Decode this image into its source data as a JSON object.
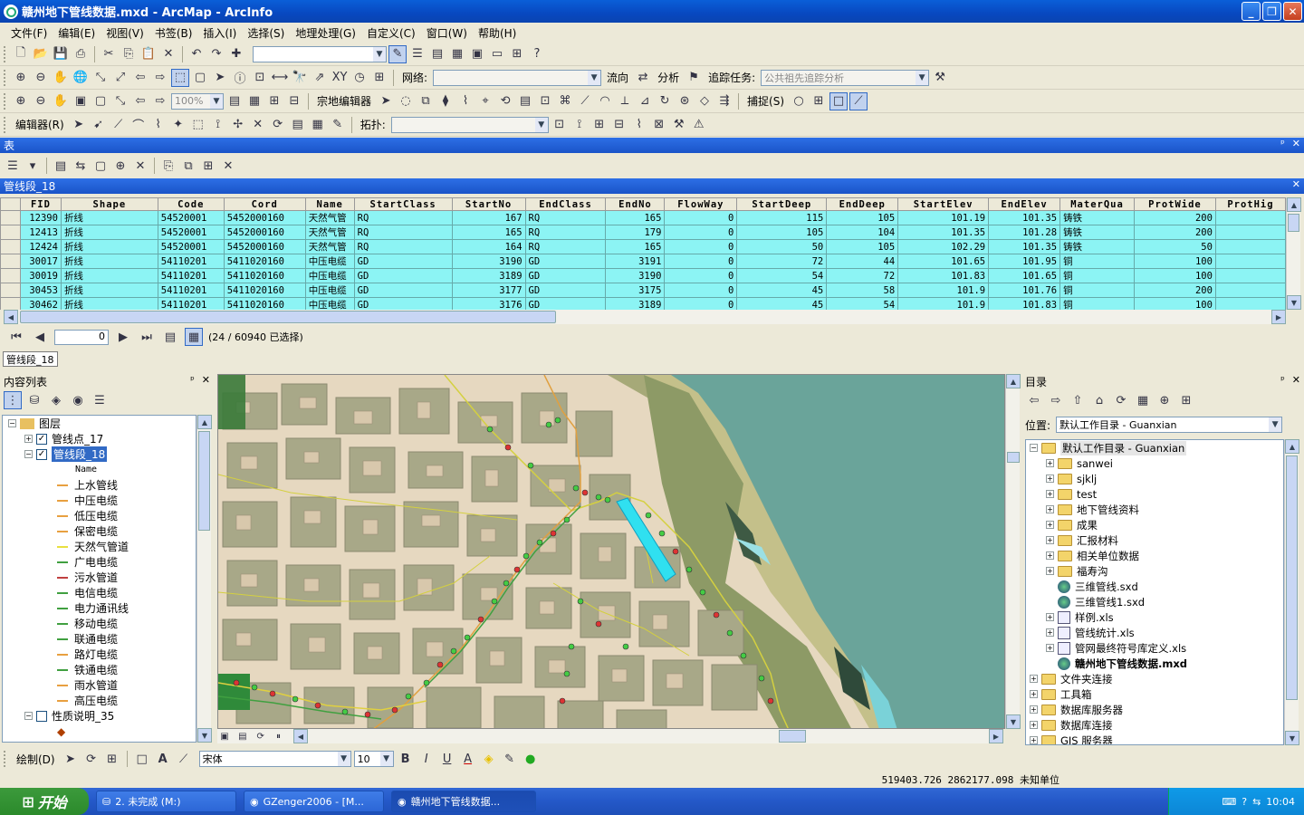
{
  "window": {
    "title": "赣州地下管线数据.mxd - ArcMap - ArcInfo",
    "min": "_",
    "max": "❐",
    "close": "✕"
  },
  "menu": [
    "文件(F)",
    "编辑(E)",
    "视图(V)",
    "书签(B)",
    "插入(I)",
    "选择(S)",
    "地理处理(G)",
    "自定义(C)",
    "窗口(W)",
    "帮助(H)"
  ],
  "toolbars": {
    "network_label": "网络:",
    "flow_label": "流向",
    "analysis_label": "分析",
    "trace_label": "追踪任务:",
    "trace_value": "公共祖先追踪分析",
    "zoom_value": "100%",
    "parcel_editor": "宗地编辑器",
    "snapping": "捕捉(S)",
    "editor": "编辑器(R)",
    "topology_label": "拓扑:"
  },
  "table_panel": {
    "title": "表",
    "layer_title": "管线段_18",
    "pin": "ᵖ",
    "close": "✕"
  },
  "table": {
    "columns": [
      "FID",
      "Shape",
      "Code",
      "Cord",
      "Name",
      "StartClass",
      "StartNo",
      "EndClass",
      "EndNo",
      "FlowWay",
      "StartDeep",
      "EndDeep",
      "StartElev",
      "EndElev",
      "MaterQua",
      "ProtWide",
      "ProtHig"
    ],
    "rows": [
      [
        "12390",
        "折线",
        "54520001",
        "5452000160",
        "天然气管",
        "RQ",
        "167",
        "RQ",
        "165",
        "0",
        "115",
        "105",
        "101.19",
        "101.35",
        "铸铁",
        "200",
        ""
      ],
      [
        "12413",
        "折线",
        "54520001",
        "5452000160",
        "天然气管",
        "RQ",
        "165",
        "RQ",
        "179",
        "0",
        "105",
        "104",
        "101.35",
        "101.28",
        "铸铁",
        "200",
        ""
      ],
      [
        "12424",
        "折线",
        "54520001",
        "5452000160",
        "天然气管",
        "RQ",
        "164",
        "RQ",
        "165",
        "0",
        "50",
        "105",
        "102.29",
        "101.35",
        "铸铁",
        "50",
        ""
      ],
      [
        "30017",
        "折线",
        "54110201",
        "5411020160",
        "中压电缆",
        "GD",
        "3190",
        "GD",
        "3191",
        "0",
        "72",
        "44",
        "101.65",
        "101.95",
        "铜",
        "100",
        ""
      ],
      [
        "30019",
        "折线",
        "54110201",
        "5411020160",
        "中压电缆",
        "GD",
        "3189",
        "GD",
        "3190",
        "0",
        "54",
        "72",
        "101.83",
        "101.65",
        "铜",
        "100",
        ""
      ],
      [
        "30453",
        "折线",
        "54110201",
        "5411020160",
        "中压电缆",
        "GD",
        "3177",
        "GD",
        "3175",
        "0",
        "45",
        "58",
        "101.9",
        "101.76",
        "铜",
        "200",
        ""
      ],
      [
        "30462",
        "折线",
        "54110201",
        "5411020160",
        "中压电缆",
        "GD",
        "3176",
        "GD",
        "3189",
        "0",
        "45",
        "54",
        "101.9",
        "101.83",
        "铜",
        "100",
        ""
      ]
    ]
  },
  "nav": {
    "record": "0",
    "selection": "(24 / 60940 已选择)",
    "tab": "管线段_18"
  },
  "toc": {
    "title": "内容列表",
    "root": "图层",
    "layers": [
      {
        "name": "管线点_17",
        "checked": true
      },
      {
        "name": "管线段_18",
        "checked": true
      }
    ],
    "field": "Name",
    "legend": [
      {
        "label": "上水管线",
        "color": "#e8a040"
      },
      {
        "label": "中压电缆",
        "color": "#e8a040"
      },
      {
        "label": "低压电缆",
        "color": "#e8a040"
      },
      {
        "label": "保密电缆",
        "color": "#e8a040"
      },
      {
        "label": "天然气管道",
        "color": "#e8e040"
      },
      {
        "label": "广电电缆",
        "color": "#40a040"
      },
      {
        "label": "污水管道",
        "color": "#c04040"
      },
      {
        "label": "电信电缆",
        "color": "#40a040"
      },
      {
        "label": "电力通讯线",
        "color": "#40a040"
      },
      {
        "label": "移动电缆",
        "color": "#40a040"
      },
      {
        "label": "联通电缆",
        "color": "#40a040"
      },
      {
        "label": "路灯电缆",
        "color": "#e8a040"
      },
      {
        "label": "铁通电缆",
        "color": "#40a040"
      },
      {
        "label": "雨水管道",
        "color": "#e8a040"
      },
      {
        "label": "高压电缆",
        "color": "#e8a040"
      }
    ],
    "extra_layer": "性质说明_35"
  },
  "catalog": {
    "title": "目录",
    "location_label": "位置:",
    "location_value": "默认工作目录 - Guanxian",
    "root": "默认工作目录 - Guanxian",
    "items": [
      {
        "label": "sanwei",
        "type": "folder"
      },
      {
        "label": "sjklj",
        "type": "folder"
      },
      {
        "label": "test",
        "type": "folder"
      },
      {
        "label": "地下管线资料",
        "type": "folder"
      },
      {
        "label": "成果",
        "type": "folder"
      },
      {
        "label": "汇报材料",
        "type": "folder"
      },
      {
        "label": "相关单位数据",
        "type": "folder"
      },
      {
        "label": "福寿沟",
        "type": "folder"
      },
      {
        "label": "三维管线.sxd",
        "type": "globe"
      },
      {
        "label": "三维管线1.sxd",
        "type": "globe"
      },
      {
        "label": "样例.xls",
        "type": "doc"
      },
      {
        "label": "管线统计.xls",
        "type": "doc"
      },
      {
        "label": "管网最终符号库定义.xls",
        "type": "doc"
      },
      {
        "label": "赣州地下管线数据.mxd",
        "type": "globe"
      }
    ],
    "top_items": [
      "文件夹连接",
      "工具箱",
      "数据库服务器",
      "数据库连接",
      "GIS 服务器"
    ]
  },
  "draw": {
    "label": "绘制(D)",
    "font": "宋体",
    "size": "10",
    "bold": "B",
    "italic": "I",
    "underline": "U",
    "font_color_glyph": "A"
  },
  "status": {
    "coords": "519403.726   2862177.098 未知单位"
  },
  "taskbar": {
    "start": "开始",
    "tasks": [
      "2. 未完成 (M:)",
      "GZenger2006 - [M...",
      "赣州地下管线数据..."
    ],
    "time": "10:04"
  }
}
